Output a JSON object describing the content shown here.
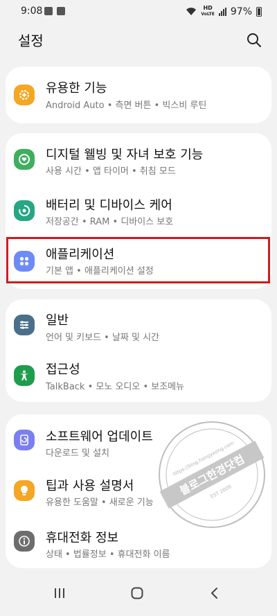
{
  "status_bar": {
    "time": "9:08",
    "network": "HD",
    "network_sub": "VoLTE",
    "battery": "97%"
  },
  "header": {
    "title": "설정"
  },
  "groups": [
    {
      "items": [
        {
          "title": "유용한 기능",
          "subtitle": "Android Auto • 측면 버튼 • 빅스비 루틴",
          "icon": "gear-plus-icon",
          "color": "#f5a623"
        }
      ]
    },
    {
      "items": [
        {
          "title": "디지털 웰빙 및 자녀 보호 기능",
          "subtitle": "사용 시간 • 앱 타이머 • 취침 모드",
          "icon": "heart-ring-icon",
          "color": "#3fae5e"
        },
        {
          "title": "배터리 및 디바이스 케어",
          "subtitle": "저장공간 • RAM • 디바이스 보호",
          "icon": "device-care-icon",
          "color": "#26a684"
        },
        {
          "title": "애플리케이션",
          "subtitle": "기본 앱 • 애플리케이션 설정",
          "icon": "apps-grid-icon",
          "color": "#6b8cf5"
        }
      ]
    },
    {
      "items": [
        {
          "title": "일반",
          "subtitle": "언어 및 키보드 • 날짜 및 시간",
          "icon": "sliders-icon",
          "color": "#4a6f8a"
        },
        {
          "title": "접근성",
          "subtitle": "TalkBack • 모노 오디오 • 보조메뉴",
          "icon": "accessibility-icon",
          "color": "#1f9d4c"
        }
      ]
    },
    {
      "items": [
        {
          "title": "소프트웨어 업데이트",
          "subtitle": "다운로드 및 설치",
          "icon": "update-icon",
          "color": "#7b7ff0"
        },
        {
          "title": "팁과 사용 설명서",
          "subtitle": "유용한 도움말 • 새로운 기능",
          "icon": "lightbulb-icon",
          "color": "#f5a623"
        },
        {
          "title": "휴대전화 정보",
          "subtitle": "상태 • 법률정보 • 휴대전화 이름",
          "icon": "info-icon",
          "color": "#6d6d6d"
        }
      ]
    }
  ],
  "watermark": {
    "text": "블로그한경닷컴",
    "url": "https://blog.hangyeong.com",
    "est": "EST 2009"
  }
}
